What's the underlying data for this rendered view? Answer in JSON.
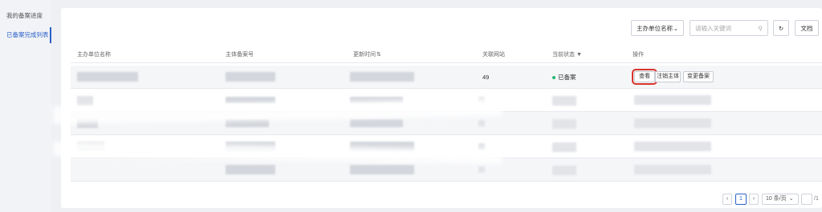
{
  "sidebar": {
    "items": [
      {
        "label": "我的备案进度"
      },
      {
        "label": "已备案完成列表"
      }
    ]
  },
  "toolbar": {
    "select_value": "主办单位名称",
    "search_placeholder": "请输入关键词",
    "document_label": "文档"
  },
  "table": {
    "headers": [
      "主办单位名称",
      "主体备案号",
      "更新时间",
      "关联网站",
      "当前状态",
      "操作"
    ],
    "rows": [
      {
        "sites": "49",
        "status": "已备案",
        "actions": [
          "查看",
          "注销主体",
          "变更备案"
        ]
      }
    ]
  },
  "pagination": {
    "page": "1",
    "page_size": "10 条/页",
    "total": "/1"
  },
  "colors": {
    "accent": "#2a62c9",
    "status_ok": "#2bb673",
    "highlight": "#d9342b"
  }
}
